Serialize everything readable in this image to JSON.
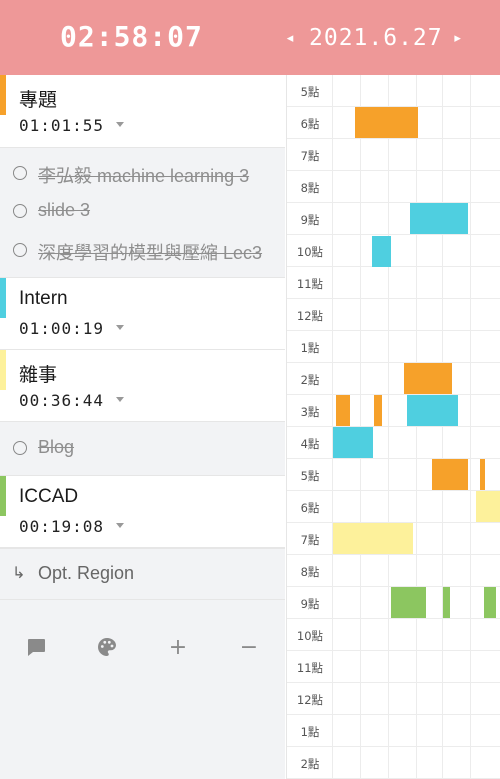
{
  "header": {
    "clock": "02:58:07",
    "date": "2021.6.27",
    "prev_arrow": "◂",
    "next_arrow": "▸",
    "background": "#ee9898"
  },
  "projects": [
    {
      "name": "專題",
      "time": "01:01:55",
      "color": "#f6a12a"
    },
    {
      "name": "Intern",
      "time": "01:00:19",
      "color": "#4fcfe0"
    },
    {
      "name": "雜事",
      "time": "00:36:44",
      "color": "#fdf19b"
    },
    {
      "name": "ICCAD",
      "time": "00:19:08",
      "color": "#8cc660"
    }
  ],
  "tasks": [
    {
      "label": "李弘毅 machine learning 3"
    },
    {
      "label": "slide 3"
    },
    {
      "label": "深度學習的模型與壓縮 Lec3"
    },
    {
      "label": "Blog"
    }
  ],
  "opt_region": {
    "label": "Opt. Region",
    "icon": "↳"
  },
  "toolbar": {
    "icons": [
      "comment-icon",
      "palette-icon",
      "plus-icon",
      "minus-icon"
    ],
    "plus": "+",
    "minus": "−"
  },
  "timeline": {
    "hours": [
      "5點",
      "6點",
      "7點",
      "8點",
      "9點",
      "10點",
      "11點",
      "12點",
      "1點",
      "2點",
      "3點",
      "4點",
      "5點",
      "6點",
      "7點",
      "8點",
      "9點",
      "10點",
      "11點",
      "12點",
      "1點",
      "2點"
    ],
    "color_legend": {
      "專題": "#f6a12a",
      "Intern": "#4fcfe0",
      "雜事": "#fdf19b",
      "ICCAD": "#8cc660"
    }
  }
}
